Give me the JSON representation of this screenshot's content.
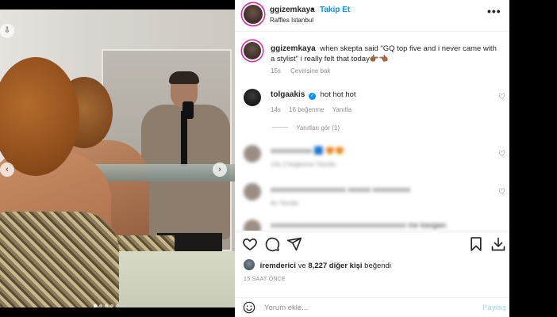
{
  "post": {
    "author": "ggizemkaya",
    "separator": "•",
    "follow_label": "Takip Et",
    "location": "Raffles Istanbul",
    "more_label": "•••"
  },
  "caption": {
    "username": "ggizemkaya",
    "text": "when skepta said \"GQ top five and i never came with a stylist\" i really felt that today👉🏾👈🏾",
    "time": "15s",
    "translate_label": "Çevirisine bak"
  },
  "comments": [
    {
      "username": "tolgaakis",
      "verified": true,
      "text": "hot hot hot",
      "time": "14s",
      "likes": "16 beğenme",
      "reply_label": "Yanıtla",
      "view_replies": "Yanıtları gör (1)"
    }
  ],
  "blurred_comments": [
    {
      "text": "xxxxxxxxxxx 🟦 😍😍",
      "meta": "14s   2 beğenme   Yanıtla"
    },
    {
      "text": "xxxxxxxxxxxxxxxxxxxx xxxxxx xxxxxxxxxx",
      "meta": "8s   Yanıtla"
    },
    {
      "text": "xxxxxxxxxxxxxxxxxxxxxxxxxxxxxxxxxxxx ine kavgası"
    }
  ],
  "likes": {
    "user": "iremderici",
    "joiner": "ve",
    "count_text": "8,227 diğer kişi",
    "suffix": "beğendi"
  },
  "time_ago": "15 SAAT ÖNCE",
  "comment_box": {
    "placeholder": "Yorum ekle...",
    "post_label": "Paylaş"
  },
  "icons": {
    "prev": "chevron-left-icon",
    "next": "chevron-right-icon",
    "like": "heart-icon",
    "comment": "comment-icon",
    "share": "paper-plane-icon",
    "save": "bookmark-icon",
    "download": "download-icon",
    "emoji": "smiley-icon"
  },
  "colors": {
    "link_blue": "#0095f6",
    "muted_text": "#8e8e8e",
    "disabled_post": "#b2dffc"
  }
}
